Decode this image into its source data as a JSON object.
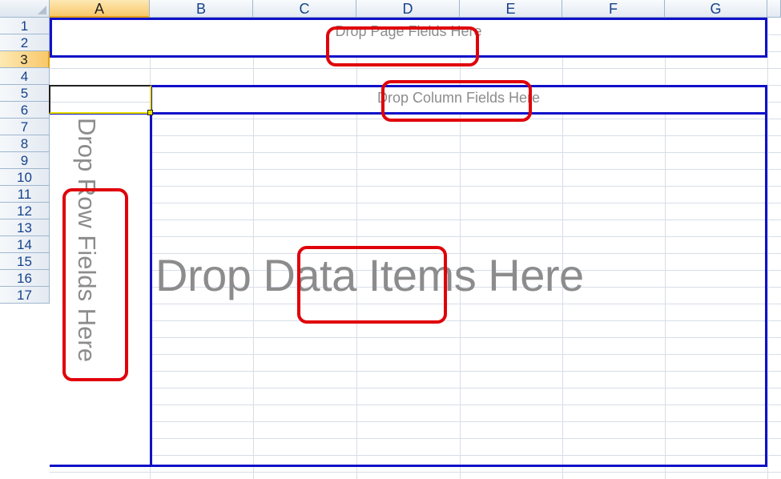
{
  "columns": [
    "A",
    "B",
    "C",
    "D",
    "E",
    "F",
    "G"
  ],
  "rows": [
    "1",
    "2",
    "3",
    "4",
    "5",
    "6",
    "7",
    "8",
    "9",
    "10",
    "11",
    "12",
    "13",
    "14",
    "15",
    "16",
    "17"
  ],
  "selected_cell": {
    "column": "A",
    "row": "3"
  },
  "pivot": {
    "page_drop_label": "Drop Page Fields Here",
    "column_drop_label": "Drop Column Fields Here",
    "row_drop_label": "Drop Row Fields Here",
    "data_drop_label": "Drop Data Items Here"
  },
  "colors": {
    "zone_border": "#1010c8",
    "callout": "#e0000a",
    "placeholder_text": "#8c8c8c",
    "header_text": "#15428b",
    "selection": "#f9c86a"
  }
}
